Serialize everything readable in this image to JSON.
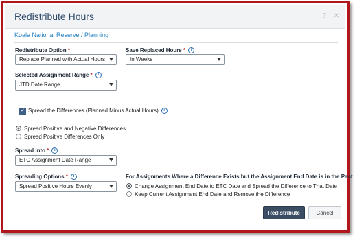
{
  "dialog": {
    "title": "Redistribute Hours",
    "help_icon": "question-mark-icon",
    "close_icon": "close-icon"
  },
  "breadcrumb": "Koala National Reserve / Planning",
  "redistribute_option": {
    "label": "Redistribute Option",
    "required": "*",
    "value": "Replace Planned with Actual Hours"
  },
  "save_replaced_hours": {
    "label": "Save Replaced Hours",
    "required": "*",
    "value": "In Weeks"
  },
  "selected_assignment_range": {
    "label": "Selected Assignment Range",
    "required": "*",
    "value": "JTD Date Range"
  },
  "spread_differences": {
    "label": "Spread the Differences (Planned Minus Actual Hours)",
    "checked": true
  },
  "spread_type": {
    "options": [
      "Spread Positive and Negative Differences",
      "Spread Positive Differences Only"
    ],
    "selected_index": 0
  },
  "spread_into": {
    "label": "Spread Into",
    "required": "*",
    "value": "ETC Assignment Date Range"
  },
  "spreading_options": {
    "label": "Spreading Options",
    "required": "*",
    "value": "Spread Positive Hours Evenly"
  },
  "end_date_section": {
    "heading": "For Assignments Where a Difference Exists but the Assignment End Date is in the Past",
    "options": [
      "Change Assignment End Date to ETC Date and Spread the Difference to That Date",
      "Keep Current Assignment End Date and Remove the Difference"
    ],
    "selected_index": 0
  },
  "buttons": {
    "primary": "Redistribute",
    "secondary": "Cancel"
  },
  "info_icon": "i"
}
